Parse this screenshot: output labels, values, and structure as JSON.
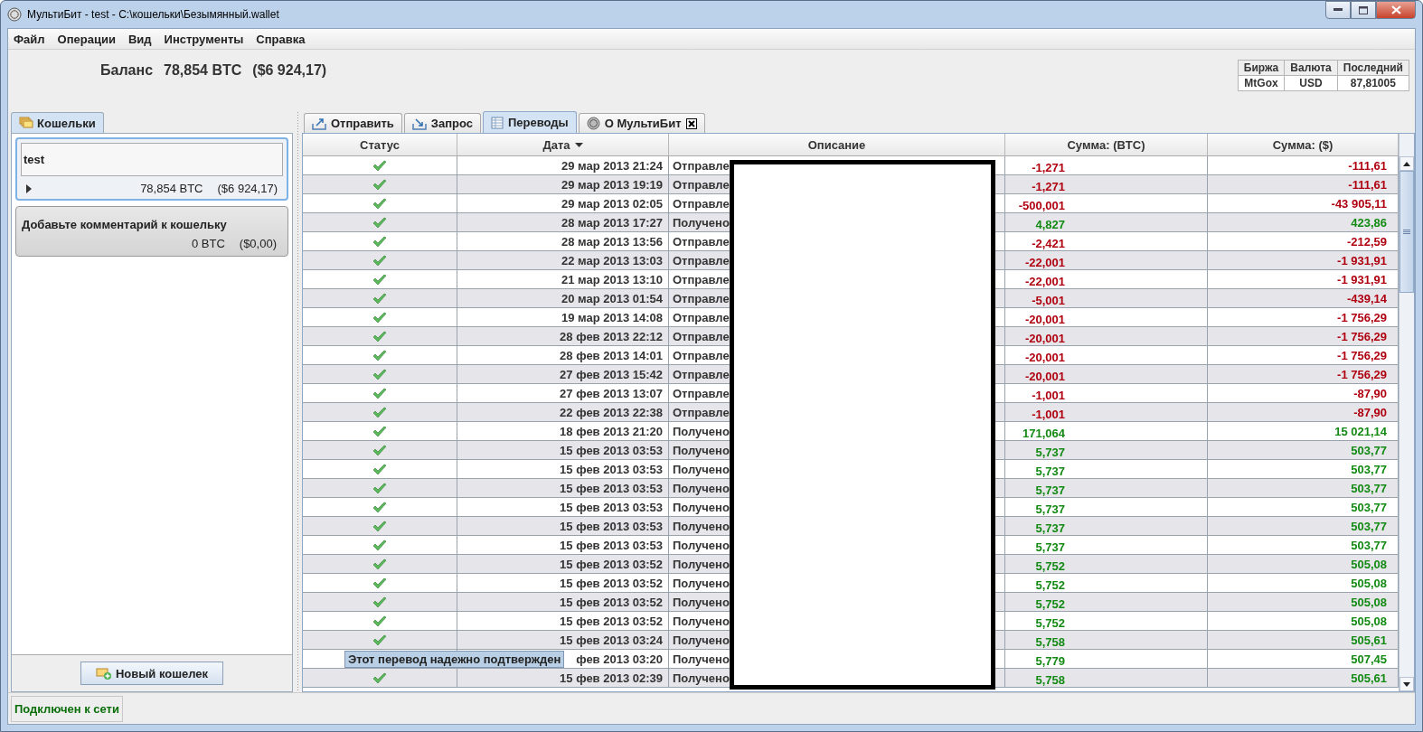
{
  "window": {
    "title": "МультиБит - test - C:\\кошельки\\Безымянный.wallet"
  },
  "menu": [
    "Файл",
    "Операции",
    "Вид",
    "Инструменты",
    "Справка"
  ],
  "balance": {
    "label": "Баланс",
    "btc": "78,854 BTC",
    "usd": "($6 924,17)"
  },
  "ticker": {
    "columns": [
      "Биржа",
      "Валюта",
      "Последний"
    ],
    "row": [
      "MtGox",
      "USD",
      "87,81005"
    ]
  },
  "wallets_tab": {
    "label": "Кошельки"
  },
  "wallets": [
    {
      "name": "test",
      "btc": "78,854 BTC",
      "usd": "($6 924,17)",
      "selected": true
    },
    {
      "name": "Добавьте комментарий к кошельку",
      "btc": "0 BTC",
      "usd": "($0,00)",
      "selected": false
    }
  ],
  "new_wallet_button": "Новый кошелек",
  "tabs": [
    {
      "label": "Отправить",
      "selected": false,
      "closable": false
    },
    {
      "label": "Запрос",
      "selected": false,
      "closable": false
    },
    {
      "label": "Переводы",
      "selected": true,
      "closable": false
    },
    {
      "label": "О МультиБит",
      "selected": false,
      "closable": true
    }
  ],
  "table": {
    "columns": [
      {
        "label": "Статус",
        "sorted": false
      },
      {
        "label": "Дата",
        "sorted": true
      },
      {
        "label": "Описание",
        "sorted": false
      },
      {
        "label": "Сумма: (BTC)",
        "sorted": false
      },
      {
        "label": "Сумма: ($)",
        "sorted": false
      }
    ],
    "rows": [
      {
        "confirmed": true,
        "date": "29 мар 2013 21:24",
        "description": "Отправле",
        "btc": "-1,271",
        "usd": "-111,61",
        "kind": "sent"
      },
      {
        "confirmed": true,
        "date": "29 мар 2013 19:19",
        "description": "Отправле",
        "btc": "-1,271",
        "usd": "-111,61",
        "kind": "sent"
      },
      {
        "confirmed": true,
        "date": "29 мар 2013 02:05",
        "description": "Отправле",
        "btc": "-500,001",
        "usd": "-43 905,11",
        "kind": "sent"
      },
      {
        "confirmed": true,
        "date": "28 мар 2013 17:27",
        "description": "Получено",
        "btc": "4,827",
        "usd": "423,86",
        "kind": "received"
      },
      {
        "confirmed": true,
        "date": "28 мар 2013 13:56",
        "description": "Отправле",
        "btc": "-2,421",
        "usd": "-212,59",
        "kind": "sent"
      },
      {
        "confirmed": true,
        "date": "22 мар 2013 13:03",
        "description": "Отправле",
        "btc": "-22,001",
        "usd": "-1 931,91",
        "kind": "sent"
      },
      {
        "confirmed": true,
        "date": "21 мар 2013 13:10",
        "description": "Отправле",
        "btc": "-22,001",
        "usd": "-1 931,91",
        "kind": "sent"
      },
      {
        "confirmed": true,
        "date": "20 мар 2013 01:54",
        "description": "Отправле",
        "btc": "-5,001",
        "usd": "-439,14",
        "kind": "sent"
      },
      {
        "confirmed": true,
        "date": "19 мар 2013 14:08",
        "description": "Отправле",
        "btc": "-20,001",
        "usd": "-1 756,29",
        "kind": "sent"
      },
      {
        "confirmed": true,
        "date": "28 фев 2013 22:12",
        "description": "Отправле",
        "btc": "-20,001",
        "usd": "-1 756,29",
        "kind": "sent"
      },
      {
        "confirmed": true,
        "date": "28 фев 2013 14:01",
        "description": "Отправле",
        "btc": "-20,001",
        "usd": "-1 756,29",
        "kind": "sent"
      },
      {
        "confirmed": true,
        "date": "27 фев 2013 15:42",
        "description": "Отправле",
        "btc": "-20,001",
        "usd": "-1 756,29",
        "kind": "sent"
      },
      {
        "confirmed": true,
        "date": "27 фев 2013 13:07",
        "description": "Отправле",
        "btc": "-1,001",
        "usd": "-87,90",
        "kind": "sent"
      },
      {
        "confirmed": true,
        "date": "22 фев 2013 22:38",
        "description": "Отправле",
        "btc": "-1,001",
        "usd": "-87,90",
        "kind": "sent"
      },
      {
        "confirmed": true,
        "date": "18 фев 2013 21:20",
        "description": "Получено",
        "btc": "171,064",
        "usd": "15 021,14",
        "kind": "received"
      },
      {
        "confirmed": true,
        "date": "15 фев 2013 03:53",
        "description": "Получено",
        "btc": "5,737",
        "usd": "503,77",
        "kind": "received"
      },
      {
        "confirmed": true,
        "date": "15 фев 2013 03:53",
        "description": "Получено",
        "btc": "5,737",
        "usd": "503,77",
        "kind": "received"
      },
      {
        "confirmed": true,
        "date": "15 фев 2013 03:53",
        "description": "Получено",
        "btc": "5,737",
        "usd": "503,77",
        "kind": "received"
      },
      {
        "confirmed": true,
        "date": "15 фев 2013 03:53",
        "description": "Получено",
        "btc": "5,737",
        "usd": "503,77",
        "kind": "received"
      },
      {
        "confirmed": true,
        "date": "15 фев 2013 03:53",
        "description": "Получено",
        "btc": "5,737",
        "usd": "503,77",
        "kind": "received"
      },
      {
        "confirmed": true,
        "date": "15 фев 2013 03:53",
        "description": "Получено",
        "btc": "5,737",
        "usd": "503,77",
        "kind": "received"
      },
      {
        "confirmed": true,
        "date": "15 фев 2013 03:52",
        "description": "Получено",
        "btc": "5,752",
        "usd": "505,08",
        "kind": "received"
      },
      {
        "confirmed": true,
        "date": "15 фев 2013 03:52",
        "description": "Получено",
        "btc": "5,752",
        "usd": "505,08",
        "kind": "received"
      },
      {
        "confirmed": true,
        "date": "15 фев 2013 03:52",
        "description": "Получено",
        "btc": "5,752",
        "usd": "505,08",
        "kind": "received"
      },
      {
        "confirmed": true,
        "date": "15 фев 2013 03:52",
        "description": "Получено",
        "btc": "5,752",
        "usd": "505,08",
        "kind": "received"
      },
      {
        "confirmed": true,
        "date": "15 фев 2013 03:24",
        "description": "Получено",
        "btc": "5,758",
        "usd": "505,61",
        "kind": "received"
      },
      {
        "tooltip": "Этот перевод надежно подтвержден",
        "date": "фев 2013 03:20",
        "description": "Получено",
        "btc": "5,779",
        "usd": "507,45",
        "kind": "received"
      },
      {
        "confirmed": true,
        "date": "15 фев 2013 02:39",
        "description": "Получено",
        "btc": "5,758",
        "usd": "505,61",
        "kind": "received"
      }
    ]
  },
  "status_bar": {
    "text": "Подключен к сети",
    "online": true
  }
}
